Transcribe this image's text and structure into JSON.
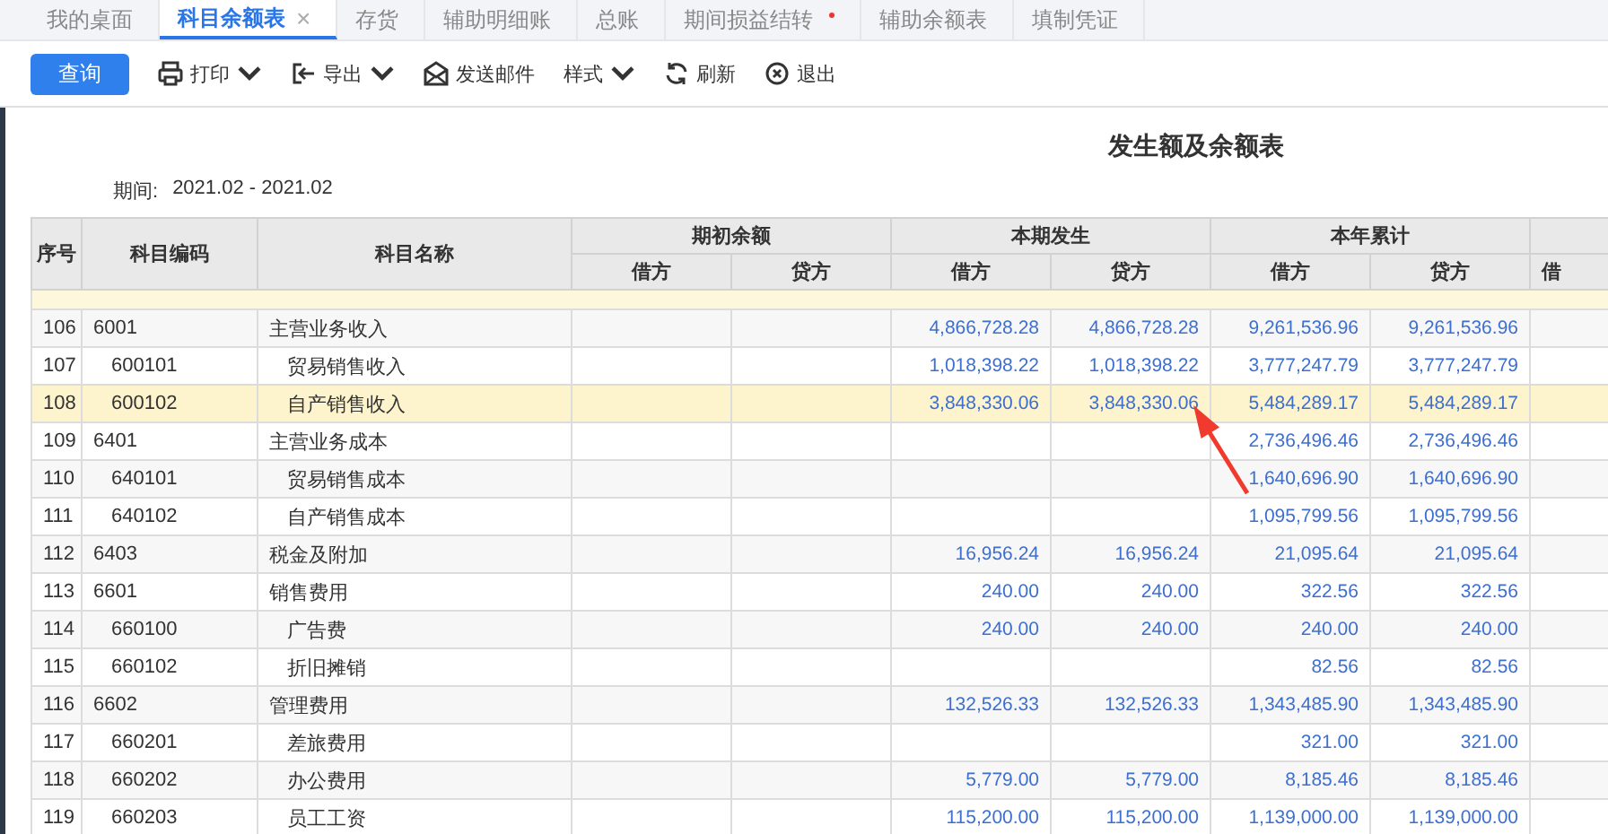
{
  "tabs": [
    {
      "label": "我的桌面",
      "selected": false
    },
    {
      "label": "科目余额表",
      "selected": true,
      "close": "×"
    },
    {
      "label": "存货",
      "selected": false
    },
    {
      "label": "辅助明细账",
      "selected": false
    },
    {
      "label": "总账",
      "selected": false
    },
    {
      "label": "期间损益结转",
      "selected": false,
      "modified": true
    },
    {
      "label": "辅助余额表",
      "selected": false
    },
    {
      "label": "填制凭证",
      "selected": false
    }
  ],
  "toolbar": {
    "primary": "查询",
    "items": [
      {
        "kind": "print",
        "label": "打印",
        "dropdown": true
      },
      {
        "kind": "export",
        "label": "导出",
        "dropdown": true
      },
      {
        "kind": "mail",
        "label": "发送邮件",
        "dropdown": false
      },
      {
        "kind": "style",
        "label": "样式",
        "dropdown": true
      },
      {
        "kind": "refresh",
        "label": "刷新",
        "dropdown": false
      },
      {
        "kind": "exit",
        "label": "退出",
        "dropdown": false
      }
    ]
  },
  "report": {
    "title": "发生额及余额表",
    "period_label": "期间:",
    "period": "2021.02 - 2021.02"
  },
  "table": {
    "columns": [
      "序号",
      "科目编码",
      "科目名称"
    ],
    "groups": [
      {
        "label": "期初余额",
        "sub": [
          "借方",
          "贷方"
        ]
      },
      {
        "label": "本期发生",
        "sub": [
          "借方",
          "贷方"
        ]
      },
      {
        "label": "本年累计",
        "sub": [
          "借方",
          "贷方"
        ]
      },
      {
        "sub": [
          "借"
        ]
      }
    ],
    "rows": [
      {
        "no": "106",
        "code": "6001",
        "name": "主营业务收入",
        "selected": false,
        "period_debit": "4,866,728.28",
        "period_credit": "4,866,728.28",
        "ytd_debit": "9,261,536.96",
        "ytd_credit": "9,261,536.96",
        "children": [
          {
            "no": "107",
            "code": "600101",
            "name": "贸易销售收入",
            "selected": false,
            "period_debit": "1,018,398.22",
            "period_credit": "1,018,398.22",
            "ytd_debit": "3,777,247.79",
            "ytd_credit": "3,777,247.79"
          },
          {
            "no": "108",
            "code": "600102",
            "name": "自产销售收入",
            "selected": true,
            "period_debit": "3,848,330.06",
            "period_credit": "3,848,330.06",
            "ytd_debit": "5,484,289.17",
            "ytd_credit": "5,484,289.17"
          }
        ]
      },
      {
        "no": "109",
        "code": "6401",
        "name": "主营业务成本",
        "selected": false,
        "ytd_debit": "2,736,496.46",
        "ytd_credit": "2,736,496.46",
        "children": [
          {
            "no": "110",
            "code": "640101",
            "name": "贸易销售成本",
            "selected": false,
            "ytd_debit": "1,640,696.90",
            "ytd_credit": "1,640,696.90"
          },
          {
            "no": "111",
            "code": "640102",
            "name": "自产销售成本",
            "selected": false,
            "ytd_debit": "1,095,799.56",
            "ytd_credit": "1,095,799.56"
          }
        ]
      },
      {
        "no": "112",
        "code": "6403",
        "name": "税金及附加",
        "selected": false,
        "period_debit": "16,956.24",
        "period_credit": "16,956.24",
        "ytd_debit": "21,095.64",
        "ytd_credit": "21,095.64"
      },
      {
        "no": "113",
        "code": "6601",
        "name": "销售费用",
        "selected": false,
        "period_debit": "240.00",
        "period_credit": "240.00",
        "ytd_debit": "322.56",
        "ytd_credit": "322.56",
        "children": [
          {
            "no": "114",
            "code": "660100",
            "name": "广告费",
            "selected": false,
            "period_debit": "240.00",
            "period_credit": "240.00",
            "ytd_debit": "240.00",
            "ytd_credit": "240.00"
          },
          {
            "no": "115",
            "code": "660102",
            "name": "折旧摊销",
            "selected": false,
            "ytd_debit": "82.56",
            "ytd_credit": "82.56"
          }
        ]
      },
      {
        "no": "116",
        "code": "6602",
        "name": "管理费用",
        "selected": false,
        "period_debit": "132,526.33",
        "period_credit": "132,526.33",
        "ytd_debit": "1,343,485.90",
        "ytd_credit": "1,343,485.90",
        "children": [
          {
            "no": "117",
            "code": "660201",
            "name": "差旅费用",
            "selected": false,
            "ytd_debit": "321.00",
            "ytd_credit": "321.00"
          },
          {
            "no": "118",
            "code": "660202",
            "name": "办公费用",
            "selected": false,
            "period_debit": "5,779.00",
            "period_credit": "5,779.00",
            "ytd_debit": "8,185.46",
            "ytd_credit": "8,185.46"
          },
          {
            "no": "119",
            "code": "660203",
            "name": "员工工资",
            "selected": false,
            "period_debit": "115,200.00",
            "period_credit": "115,200.00",
            "ytd_debit": "1,139,000.00",
            "ytd_credit": "1,139,000.00"
          }
        ]
      }
    ]
  }
}
